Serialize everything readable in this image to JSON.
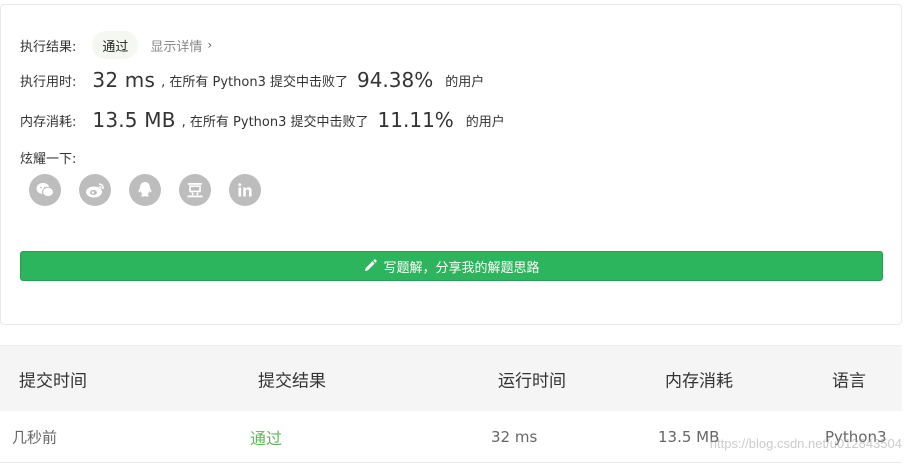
{
  "result": {
    "label": "执行结果:",
    "status": "通过",
    "detail_link": "显示详情"
  },
  "runtime": {
    "label": "执行用时:",
    "value": "32 ms",
    "beat_text": ", 在所有 Python3 提交中击败了",
    "percent": "94.38%",
    "suffix": "的用户"
  },
  "memory": {
    "label": "内存消耗:",
    "value": "13.5 MB",
    "beat_text": ", 在所有 Python3 提交中击败了",
    "percent": "11.11%",
    "suffix": "的用户"
  },
  "share": {
    "label": "炫耀一下:",
    "icons": [
      "wechat-icon",
      "weibo-icon",
      "qq-icon",
      "douban-icon",
      "linkedin-icon"
    ]
  },
  "write_solution_button": "写题解，分享我的解题思路",
  "table": {
    "headers": [
      "提交时间",
      "提交结果",
      "运行时间",
      "内存消耗",
      "语言"
    ],
    "rows": [
      [
        "几秒前",
        "通过",
        "32 ms",
        "13.5 MB",
        "Python3"
      ]
    ]
  },
  "watermark": "https://blog.csdn.net/u012843504",
  "colors": {
    "accent_green": "#2db55d",
    "passed_green": "#5cb85c",
    "icon_gray": "#bdbdbd"
  }
}
